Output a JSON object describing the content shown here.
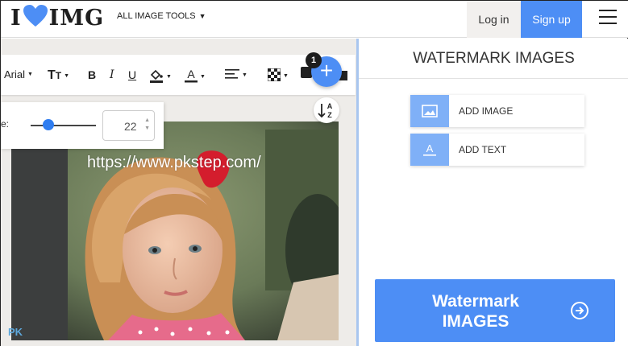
{
  "header": {
    "logo": {
      "part1": "I",
      "part2": "IMG"
    },
    "tools_menu": "ALL IMAGE TOOLS",
    "login": "Log in",
    "signup": "Sign up"
  },
  "toolbar": {
    "font": "Arial",
    "badge_count": "1"
  },
  "canvas": {
    "watermark_text": "https://www.pkstep.com/",
    "corner_mark": "PK"
  },
  "size_panel": {
    "label": "e:",
    "value": "22",
    "slider_fraction": 0.27
  },
  "panel": {
    "title": "WATERMARK IMAGES",
    "add_image": "ADD IMAGE",
    "add_text": "ADD TEXT",
    "action_line1": "Watermark",
    "action_line2": "IMAGES"
  },
  "colors": {
    "accent": "#4d8ef5",
    "icon_box": "#7fb0f7",
    "heart": "#4d8ef5"
  }
}
